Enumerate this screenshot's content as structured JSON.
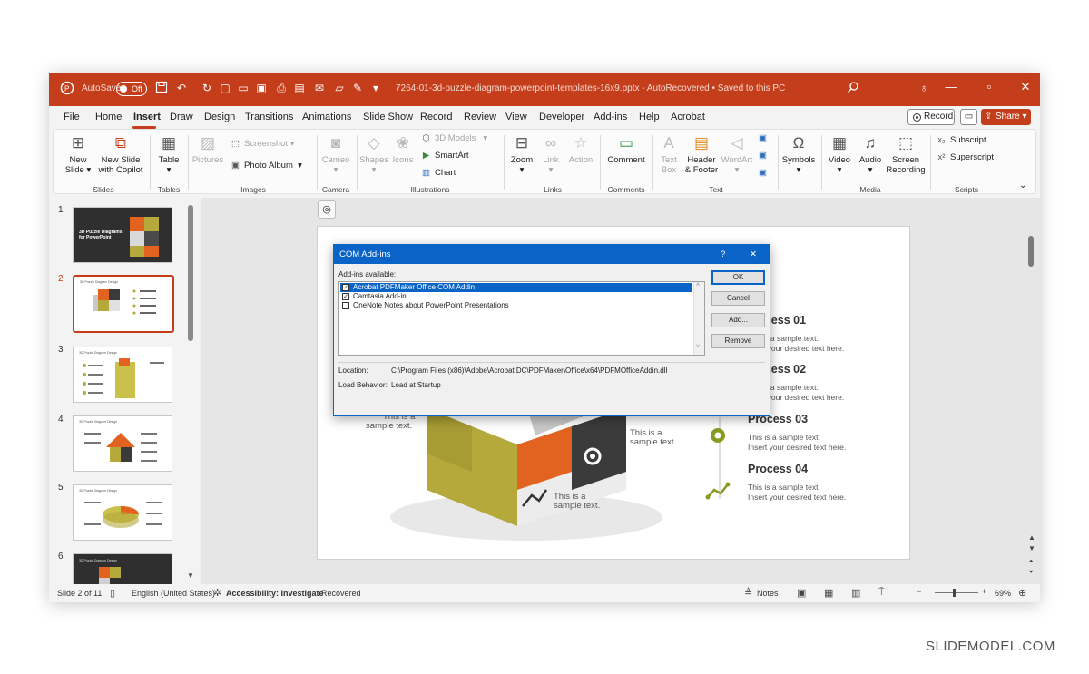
{
  "title_bar": {
    "autosave_label": "AutoSave",
    "autosave_state": "Off",
    "document_title": "7264-01-3d-puzzle-diagram-powerpoint-templates-16x9.pptx  -  AutoRecovered  •  Saved to this PC",
    "icons": [
      "powerpoint-icon",
      "save-icon",
      "undo-icon",
      "redo-icon",
      "search-icon",
      "lightbulb-icon",
      "minimize-icon",
      "restore-icon",
      "close-icon"
    ]
  },
  "menu": {
    "items": [
      "File",
      "Home",
      "Insert",
      "Draw",
      "Design",
      "Transitions",
      "Animations",
      "Slide Show",
      "Record",
      "Review",
      "View",
      "Developer",
      "Add-ins",
      "Help",
      "Acrobat"
    ],
    "active": "Insert",
    "record_label": "Record",
    "share_label": "Share"
  },
  "ribbon": {
    "slides": {
      "new_slide": "New Slide",
      "new_slide_copilot": "New Slide with Copilot",
      "label": "Slides"
    },
    "tables": {
      "table": "Table",
      "label": "Tables"
    },
    "images": {
      "pictures": "Pictures",
      "screenshot": "Screenshot",
      "photo_album": "Photo Album",
      "label": "Images"
    },
    "camera": {
      "cameo": "Cameo",
      "label": "Camera"
    },
    "illustrations": {
      "shapes": "Shapes",
      "icons": "Icons",
      "models": "3D Models",
      "smartart": "SmartArt",
      "chart": "Chart",
      "label": "Illustrations"
    },
    "links": {
      "zoom": "Zoom",
      "link": "Link",
      "action": "Action",
      "label": "Links"
    },
    "comments": {
      "comment": "Comment",
      "label": "Comments"
    },
    "text": {
      "text_box": "Text Box",
      "header_footer": "Header & Footer",
      "wordart": "WordArt",
      "label": "Text"
    },
    "symbols": {
      "symbols": "Symbols",
      "label": ""
    },
    "media": {
      "video": "Video",
      "audio": "Audio",
      "screen_recording": "Screen Recording",
      "label": "Media"
    },
    "scripts": {
      "subscript": "Subscript",
      "superscript": "Superscript",
      "label": "Scripts"
    }
  },
  "thumbnails": [
    {
      "number": "1",
      "caption": "3D Puzzle Diagrams for PowerPoint"
    },
    {
      "number": "2",
      "caption": "3D Puzzle Diagram Design"
    },
    {
      "number": "3",
      "caption": "3D Puzzle Diagram Design"
    },
    {
      "number": "4",
      "caption": "3D Puzzle Diagram Design"
    },
    {
      "number": "5",
      "caption": "3D Puzzle Diagram Design"
    },
    {
      "number": "6",
      "caption": "3D Puzzle Diagram Design"
    }
  ],
  "slide": {
    "processes": [
      {
        "title": "Process 01",
        "line1": "This is a sample text.",
        "line2": "Insert your desired text here."
      },
      {
        "title": "Process 02",
        "line1": "This is a sample text.",
        "line2": "Insert your desired text here."
      },
      {
        "title": "Process 03",
        "line1": "This is a sample text.",
        "line2": "Insert your desired text here."
      },
      {
        "title": "Process 04",
        "line1": "This is a sample text.",
        "line2": "Insert your desired text here."
      }
    ],
    "sample_line1": "This is a",
    "sample_line2": "sample text."
  },
  "dialog": {
    "title": "COM Add-ins",
    "help": "?",
    "close": "✕",
    "available_label": "Add-ins available:",
    "addins": [
      {
        "name": "Acrobat PDFMaker Office COM Addin",
        "checked": true,
        "selected": true
      },
      {
        "name": "Camtasia Add-in",
        "checked": true,
        "selected": false
      },
      {
        "name": "OneNote Notes about PowerPoint Presentations",
        "checked": false,
        "selected": false
      }
    ],
    "buttons": {
      "ok": "OK",
      "cancel": "Cancel",
      "add": "Add...",
      "remove": "Remove"
    },
    "location_label": "Location:",
    "location_value": "C:\\Program Files (x86)\\Adobe\\Acrobat DC\\PDFMaker\\Office\\x64\\PDFMOfficeAddin.dll",
    "behavior_label": "Load Behavior:",
    "behavior_value": "Load at Startup"
  },
  "status_bar": {
    "slide_count": "Slide 2 of 11",
    "language": "English (United States)",
    "accessibility": "Accessibility: Investigate",
    "recovered": "Recovered",
    "notes": "Notes",
    "zoom": "69%"
  },
  "watermark": "SLIDEMODEL.COM",
  "colors": {
    "accent": "#c43e1c",
    "dialog_blue": "#0a64c8",
    "puzzle_olive": "#b5a93b",
    "puzzle_orange": "#e2621f",
    "puzzle_dark": "#3b3b3b"
  }
}
